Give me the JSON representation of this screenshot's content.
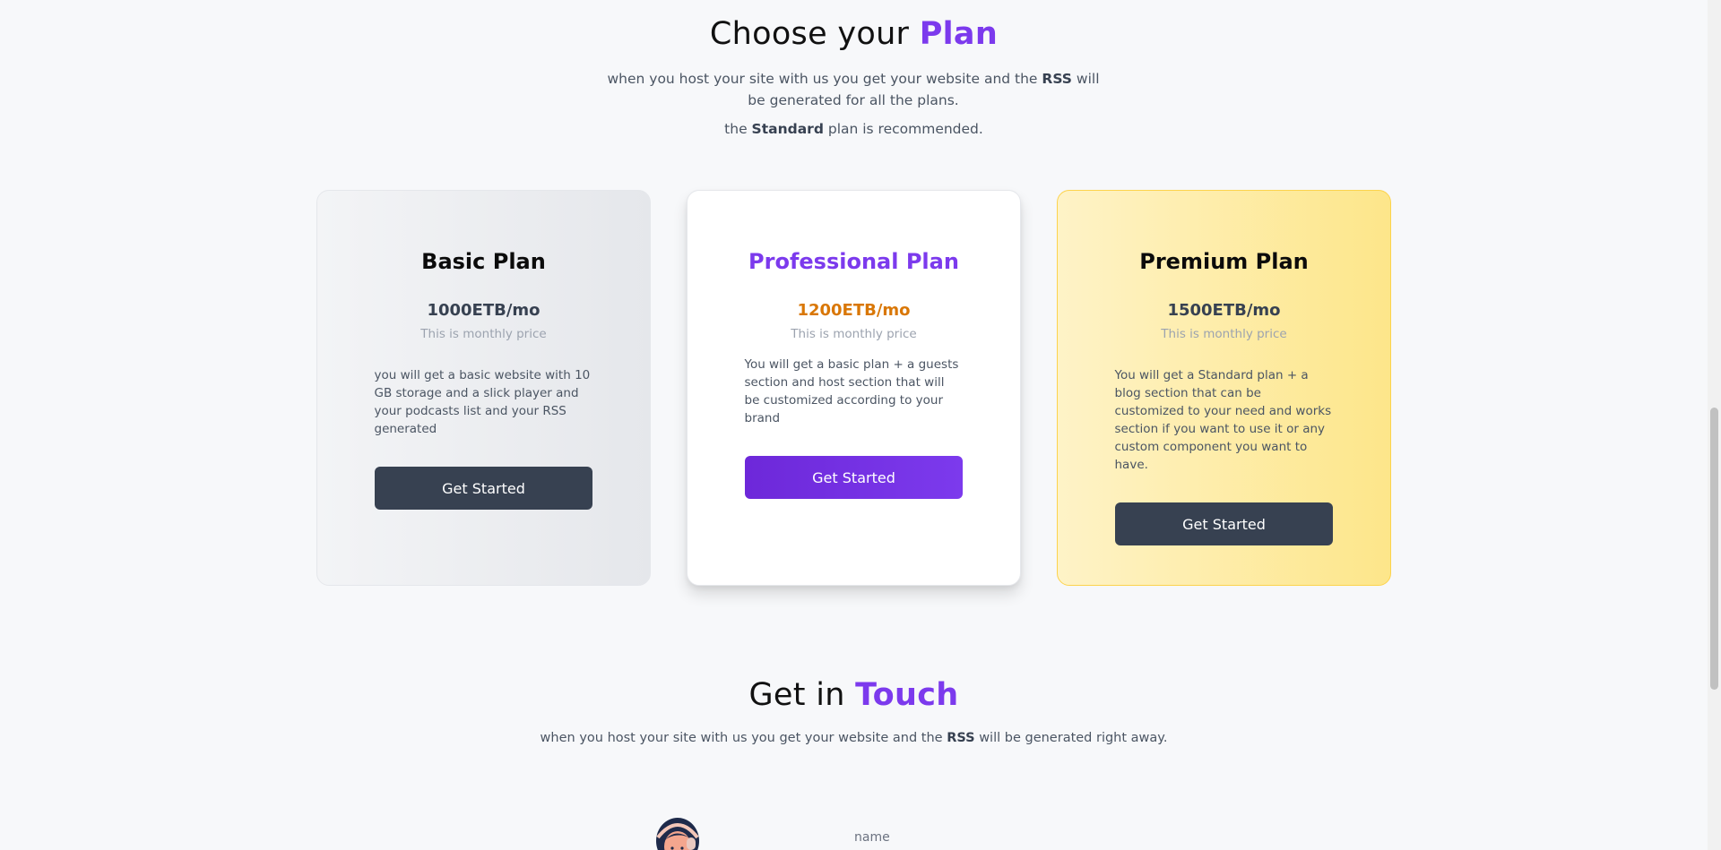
{
  "plans_section": {
    "title_prefix": "Choose your ",
    "title_accent": "Plan",
    "intro_before": "when you host your site with us you get your website and the ",
    "intro_bold": "RSS",
    "intro_after": " will be generated for all the plans.",
    "rec_before": "the ",
    "rec_bold": "Standard",
    "rec_after": " plan is recommended."
  },
  "plans": [
    {
      "name": "Basic Plan",
      "price": "1000ETB/mo",
      "price_note": "This is monthly price",
      "description": "you will get a basic website with 10 GB storage and a slick player and your podcasts list and your RSS generated",
      "button": "Get Started"
    },
    {
      "name": "Professional Plan",
      "price": "1200ETB/mo",
      "price_note": "This is monthly price",
      "description": "You will get a basic plan + a guests section and host section that will be customized according to your brand",
      "button": "Get Started"
    },
    {
      "name": "Premium Plan",
      "price": "1500ETB/mo",
      "price_note": "This is monthly price",
      "description": "You will get a Standard plan + a blog section that can be customized to your need and works section if you want to use it or any custom component you want to have.",
      "button": "Get Started"
    }
  ],
  "contact_section": {
    "title_prefix": "Get in ",
    "title_accent": "Touch",
    "intro_before": "when you host your site with us you get your website and the ",
    "intro_bold": "RSS",
    "intro_after": " will be generated right away.",
    "name_label": "name"
  },
  "colors": {
    "accent": "#7c3aed",
    "pro_price": "#d97706",
    "dark_button": "#374151"
  }
}
